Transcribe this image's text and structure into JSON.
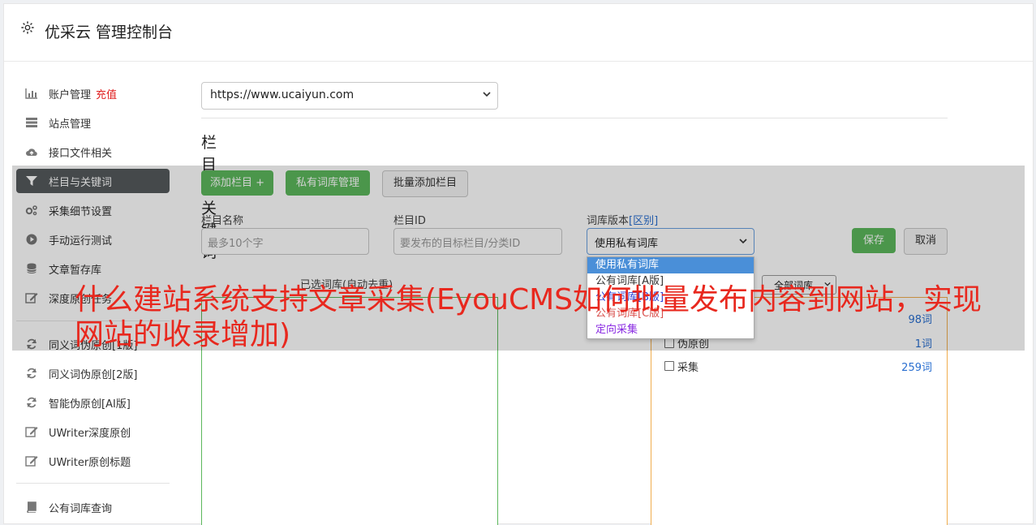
{
  "app": {
    "title": "优采云 管理控制台"
  },
  "sidebar": {
    "items": [
      {
        "label": "账户管理",
        "badge": "充值",
        "icon": "bar-chart-icon"
      },
      {
        "label": "站点管理",
        "icon": "server-icon"
      },
      {
        "label": "接口文件相关",
        "icon": "cloud-upload-icon"
      },
      {
        "label": "栏目与关键词",
        "icon": "filter-icon",
        "active": true
      },
      {
        "label": "采集细节设置",
        "icon": "cogs-icon"
      },
      {
        "label": "手动运行测试",
        "icon": "play-circle-icon"
      },
      {
        "label": "文章暂存库",
        "icon": "database-icon"
      },
      {
        "label": "深度原创任务",
        "icon": "edit-icon"
      },
      {
        "label": "同义词伪原创[1版]",
        "icon": "refresh-icon"
      },
      {
        "label": "同义词伪原创[2版]",
        "icon": "refresh-icon"
      },
      {
        "label": "智能伪原创[AI版]",
        "icon": "refresh-icon"
      },
      {
        "label": "UWriter深度原创",
        "icon": "edit-icon"
      },
      {
        "label": "UWriter原创标题",
        "icon": "edit-icon"
      },
      {
        "label": "公有词库查询",
        "icon": "book-icon"
      }
    ]
  },
  "main": {
    "site_select": {
      "value": "https://www.ucaiyun.com"
    },
    "section_title": "栏目与关键词",
    "buttons": {
      "add_column": "添加栏目 +",
      "private_lib": "私有词库管理",
      "batch_add": "批量添加栏目",
      "save": "保存",
      "cancel": "取消"
    },
    "form": {
      "name_label": "栏目名称",
      "name_placeholder": "最多10个字",
      "id_label": "栏目ID",
      "id_placeholder": "要发布的目标栏目/分类ID",
      "version_label": "词库版本",
      "version_link": "[区别]",
      "version_value": "使用私有词库"
    },
    "dropdown": {
      "options": [
        {
          "label": "使用私有词库",
          "color": "#ffffff",
          "selected": true
        },
        {
          "label": "公有词库[A版]",
          "color": "#333333"
        },
        {
          "label": "公有词库[B版]",
          "color": "#2a3fd8"
        },
        {
          "label": "公有词库[C版]",
          "color": "#d9534f"
        },
        {
          "label": "定向采集",
          "color": "#8a2be2"
        }
      ]
    },
    "panels": {
      "left_caption": "已选词库(自动去重)",
      "right_filter": "全部词库",
      "right_rows": [
        {
          "label": "",
          "count": "98词"
        },
        {
          "label": "伪原创",
          "count": "1词"
        },
        {
          "label": "采集",
          "count": "259词"
        }
      ]
    }
  },
  "overlay": {
    "headline": "什么建站系统支持文章采集(EyouCMS如何批量发布内容到网站，实现网站的收录增加)"
  },
  "colors": {
    "accent_green": "#5cb85c",
    "active_nav": "#55595c",
    "headline_red": "#e8281e",
    "link_blue": "#2a6fd0"
  }
}
